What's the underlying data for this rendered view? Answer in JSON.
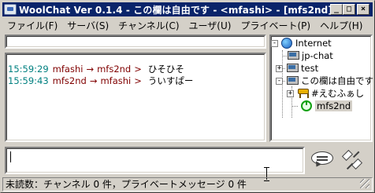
{
  "window": {
    "title": "WoolChat Ver 0.1.4 - この欄は自由です - <mfashi> - [mfs2nd]",
    "minimize_label": "_",
    "maximize_label": "□",
    "close_label": "×"
  },
  "menu": [
    "ファイル(F)",
    "サーバ(S)",
    "チャンネル(C)",
    "ユーザ(U)",
    "プライベート(P)",
    "ヘルプ(H)"
  ],
  "topic": {
    "value": ""
  },
  "chat": {
    "lines": [
      {
        "time": "15:59:29",
        "from": "mfashi",
        "arrow": "→",
        "to": "mfs2nd",
        "gt": ">",
        "msg": "ひそひそ"
      },
      {
        "time": "15:59:43",
        "from": "mfs2nd",
        "arrow": "→",
        "to": "mfashi",
        "gt": ">",
        "msg": "ういすぱー"
      }
    ]
  },
  "tree": {
    "root": {
      "label": "Internet",
      "icon": "globe-icon",
      "expander": "-"
    },
    "servers": [
      {
        "label": "jp-chat",
        "icon": "computer-icon"
      },
      {
        "label": "test",
        "icon": "computer-icon",
        "expander": "+"
      },
      {
        "label": "この欄は自由です",
        "icon": "computer-icon",
        "expander": "-"
      }
    ],
    "children": [
      {
        "label": "#えむふぁし",
        "icon": "channel-stool-icon",
        "expander": "+"
      },
      {
        "label": "mfs2nd",
        "icon": "power-user-icon",
        "selected": true
      }
    ]
  },
  "input": {
    "value": ""
  },
  "status": {
    "text": "未読数：チャンネル 0 件，プライベートメッセージ 0 件"
  },
  "colors": {
    "titlebar": "#0a246a",
    "chrome": "#d4d0c8",
    "time": "#008080",
    "nick": "#800000"
  }
}
